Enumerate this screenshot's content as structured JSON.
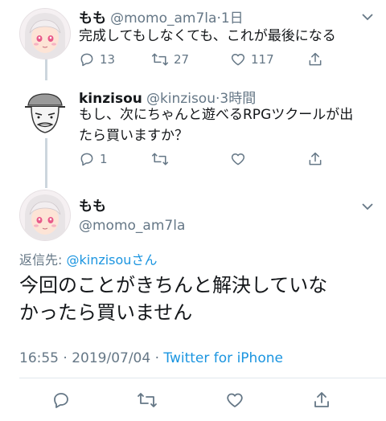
{
  "tweets": [
    {
      "name": "もも",
      "handle": "@momo_am7la",
      "time": "·1日",
      "text": "完成してもしなくても、これが最後になる",
      "replies": "13",
      "retweets": "27",
      "likes": "117"
    },
    {
      "name": "kinzisou",
      "handle": "@kinzisou",
      "time": "·3時間",
      "text_line1": "もし、次にちゃんと遊べるRPGツクールが出",
      "text_line2": "たら買いますか？",
      "replies": "1"
    }
  ],
  "main": {
    "name": "もも",
    "handle": "@momo_am7la",
    "reply_to_label": "返信先: ",
    "reply_to_handle": "@kinzisouさん",
    "text_line1": "今回のことがきちんと解決していな",
    "text_line2": "かったら買いません",
    "date": "16:55 · 2019/07/04 · ",
    "client": "Twitter for iPhone"
  },
  "icons": {
    "reply": "reply-icon",
    "retweet": "retweet-icon",
    "like": "heart-icon",
    "share": "share-icon",
    "more": "chevron-down-icon"
  },
  "colors": {
    "link": "#1b95e0",
    "secondary": "#657786",
    "line": "#ccd6dd"
  }
}
